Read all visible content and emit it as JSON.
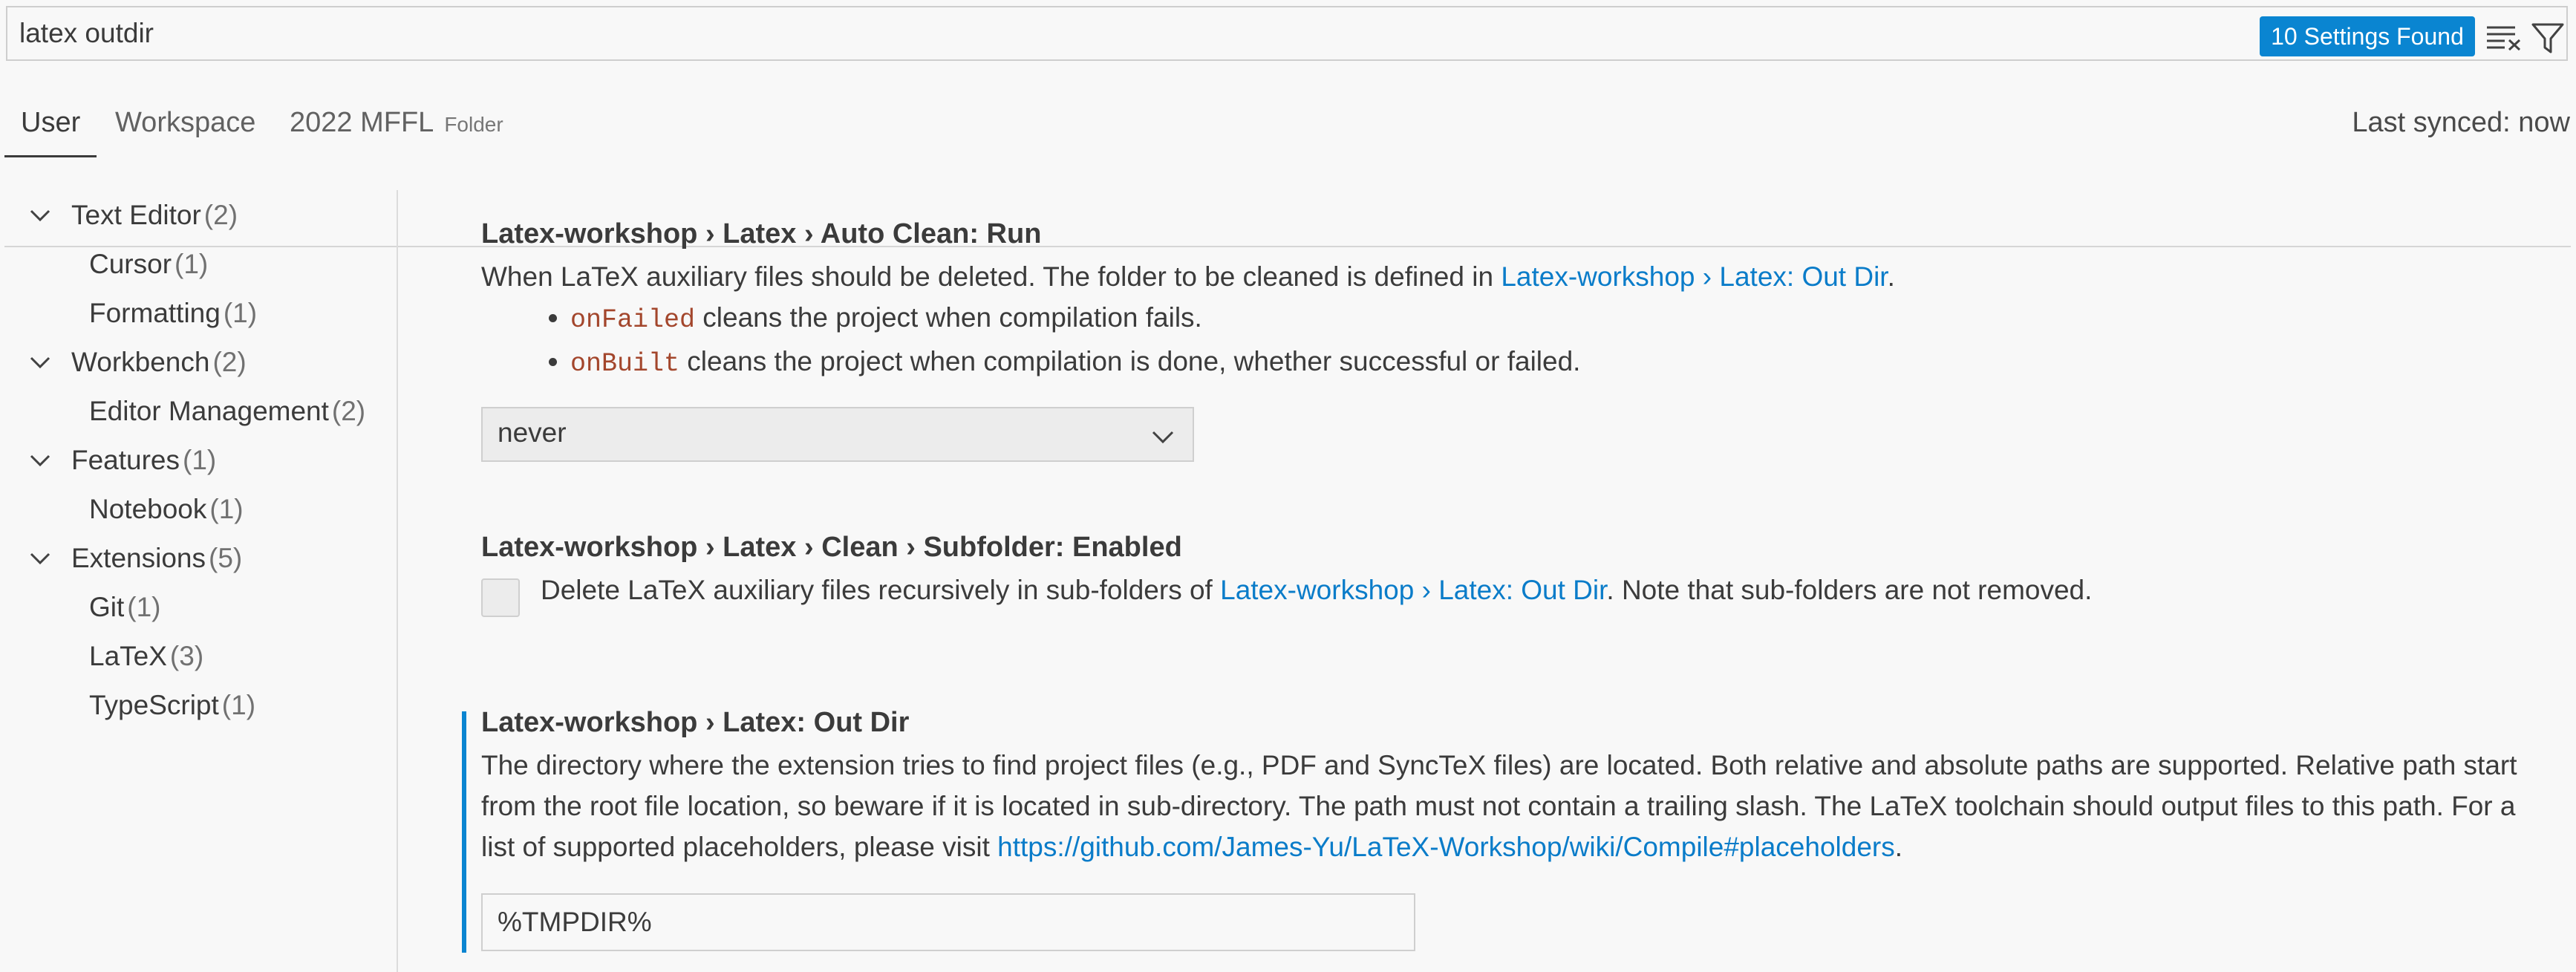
{
  "search": {
    "value": "latex outdir",
    "results_badge": "10 Settings Found"
  },
  "tabs": {
    "user": "User",
    "workspace": "Workspace",
    "folder_name": "2022 MFFL",
    "folder_label": "Folder",
    "last_synced": "Last synced: now"
  },
  "toc": {
    "text_editor": {
      "label": "Text Editor",
      "count": "(2)"
    },
    "cursor": {
      "label": "Cursor",
      "count": "(1)"
    },
    "formatting": {
      "label": "Formatting",
      "count": "(1)"
    },
    "workbench": {
      "label": "Workbench",
      "count": "(2)"
    },
    "editor_management": {
      "label": "Editor Management",
      "count": "(2)"
    },
    "features": {
      "label": "Features",
      "count": "(1)"
    },
    "notebook": {
      "label": "Notebook",
      "count": "(1)"
    },
    "extensions": {
      "label": "Extensions",
      "count": "(5)"
    },
    "git": {
      "label": "Git",
      "count": "(1)"
    },
    "latex": {
      "label": "LaTeX",
      "count": "(3)"
    },
    "typescript": {
      "label": "TypeScript",
      "count": "(1)"
    }
  },
  "settings": {
    "auto_clean": {
      "title": "Latex-workshop › Latex › Auto Clean: Run",
      "desc_prefix": "When LaTeX auxiliary files should be deleted. The folder to be cleaned is defined in ",
      "desc_link": "Latex-workshop › Latex: Out Dir",
      "desc_suffix": ".",
      "bullet1_code": "onFailed",
      "bullet1_text": " cleans the project when compilation fails.",
      "bullet2_code": "onBuilt",
      "bullet2_text": " cleans the project when compilation is done, whether successful or failed.",
      "select_value": "never"
    },
    "clean_subfolder": {
      "title": "Latex-workshop › Latex › Clean › Subfolder: Enabled",
      "desc_prefix": "Delete LaTeX auxiliary files recursively in sub-folders of ",
      "desc_link": "Latex-workshop › Latex: Out Dir",
      "desc_suffix": ". Note that sub-folders are not removed.",
      "checked": false
    },
    "out_dir": {
      "title": "Latex-workshop › Latex: Out Dir",
      "desc_prefix": "The directory where the extension tries to find project files (e.g., PDF and SyncTeX files) are located. Both relative and absolute paths are supported. Relative path start from the root file location, so beware if it is located in sub-directory. The path must not contain a trailing slash. The LaTeX toolchain should output files to this path. For a list of supported placeholders, please visit ",
      "desc_link": "https://github.com/James-Yu/LaTeX-Workshop/wiki/Compile#placeholders",
      "desc_suffix": ".",
      "value": "%TMPDIR%"
    }
  },
  "colors": {
    "accent": "#0a85d1",
    "link": "#0a7cc9",
    "code": "#a3462c"
  }
}
